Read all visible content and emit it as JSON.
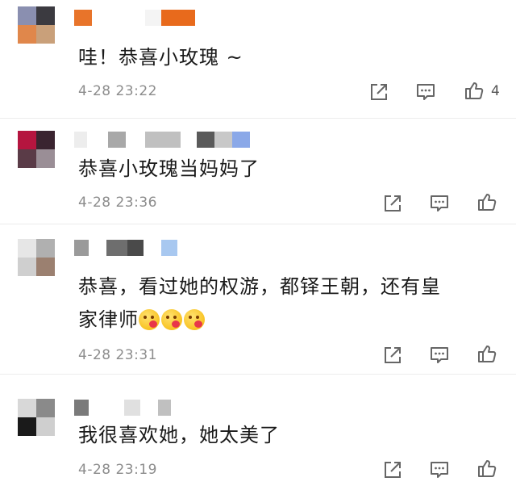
{
  "comments": [
    {
      "text": "哇！恭喜小玫瑰 ~",
      "time": "4-28 23:22",
      "likes": "4",
      "avatar_colors": [
        "#8a8fb0",
        "#3b3a40",
        "#e0874b",
        "#c9a07a"
      ],
      "name_colors": [
        "#e8742a",
        "#f0f0f0",
        "#e86a1c"
      ]
    },
    {
      "text": "恭喜小玫瑰当妈妈了",
      "time": "4-28 23:36",
      "likes": "",
      "avatar_colors": [
        "#b5153f",
        "#3a2430",
        "#5a3b47",
        "#9a8e96"
      ],
      "name_colors": [
        "#d0d0d0",
        "#a8a8a8",
        "#bdbdbd",
        "#5a5a5a",
        "#c8c8c8",
        "#8aa8e8"
      ]
    },
    {
      "text": "恭喜，看过她的权游，都铎王朝，还有皇",
      "text2": "家律师",
      "emoji_count": 3,
      "time": "4-28 23:31",
      "likes": "",
      "avatar_colors": [
        "#e6e6e6",
        "#b0b0b0",
        "#cfcfcf",
        "#9b8070"
      ],
      "name_colors": [
        "#9a9a9a",
        "#6e6e6e",
        "#4a4a4a",
        "#a8c8f0"
      ]
    },
    {
      "text": "我很喜欢她，她太美了",
      "time": "4-28 23:19",
      "likes": "",
      "avatar_colors": [
        "#d8d8d8",
        "#8a8a8a",
        "#1a1a1a",
        "#cfcfcf"
      ],
      "name_colors": [
        "#7a7a7a",
        "#e0e0e0",
        "#c0c0c0"
      ]
    }
  ],
  "icons": {
    "share": "share-icon",
    "comment": "comment-icon",
    "like": "thumbs-up-icon"
  },
  "colors": {
    "time": "#8c8c8c",
    "text": "#1a1a1a",
    "divider": "#ececec"
  }
}
